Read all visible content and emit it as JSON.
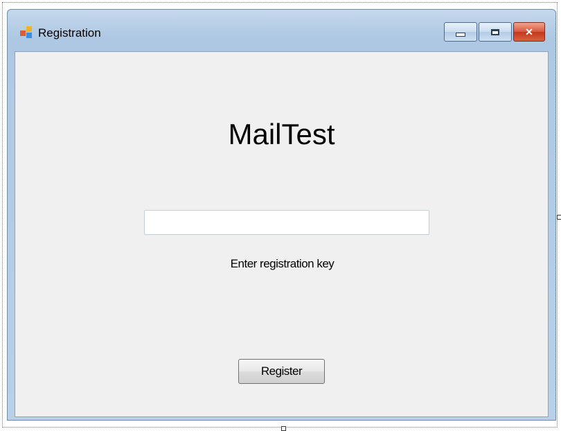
{
  "window": {
    "title": "Registration",
    "minimize_glyph": "minimize-icon",
    "maximize_glyph": "maximize-icon",
    "close_glyph": "✕"
  },
  "form": {
    "app_title": "MailTest",
    "key_input_value": "",
    "key_label": "Enter registration key",
    "register_label": "Register"
  }
}
